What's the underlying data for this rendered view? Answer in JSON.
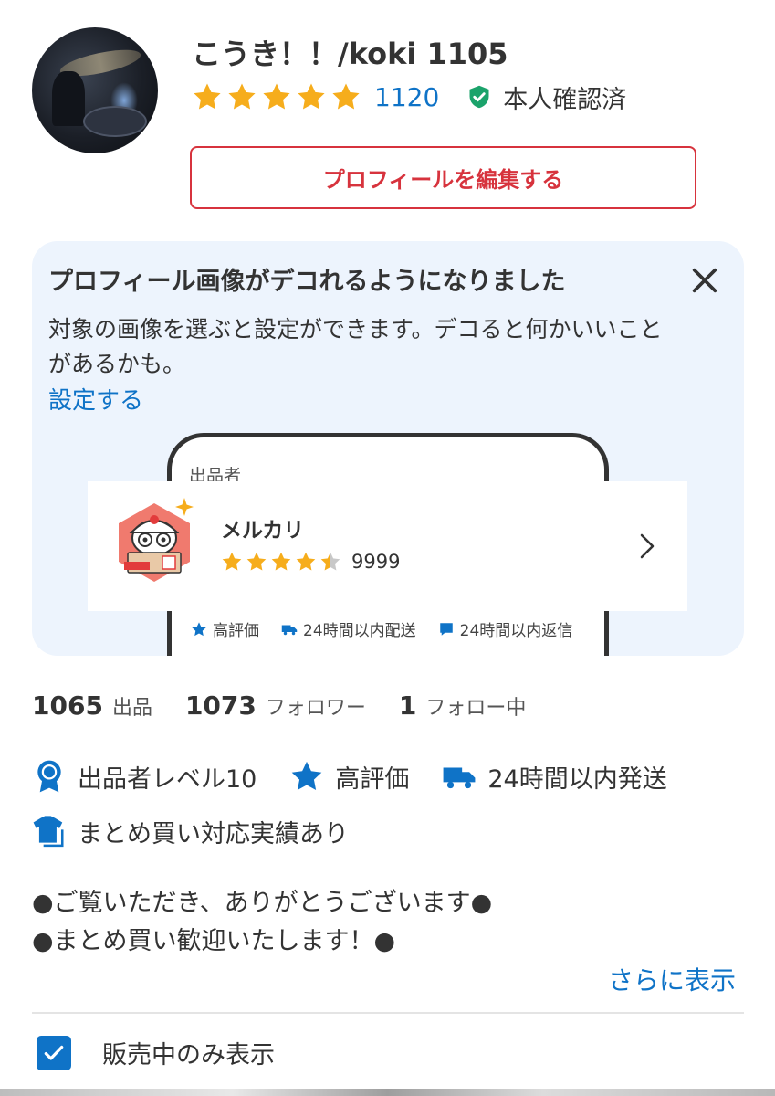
{
  "profile": {
    "username": "こうき！！/koki 1105",
    "rating_count": "1120",
    "rating_stars": 5,
    "verified_label": "本人確認済",
    "edit_button": "プロフィールを編集する"
  },
  "notice": {
    "title": "プロフィール画像がデコれるようになりました",
    "body": "対象の画像を選ぶと設定ができます。デコると何かいいことがあるかも。",
    "link": "設定する",
    "preview": {
      "seller_label": "出品者",
      "seller_name": "メルカリ",
      "seller_rating": 4.5,
      "seller_count": "9999",
      "badges": [
        "高評価",
        "24時間以内配送",
        "24時間以内返信"
      ]
    }
  },
  "stats": [
    {
      "value": "1065",
      "label": "出品"
    },
    {
      "value": "1073",
      "label": "フォロワー"
    },
    {
      "value": "1",
      "label": "フォロー中"
    }
  ],
  "badges": {
    "level": "出品者レベル10",
    "high_rating": "高評価",
    "shipping": "24時間以内発送",
    "bulk": "まとめ買い対応実績あり"
  },
  "description": {
    "line1": "●ご覧いただき、ありがとうございます●",
    "line2": "●まとめ買い歓迎いたします！●",
    "more": "さらに表示"
  },
  "filter": {
    "label": "販売中のみ表示",
    "checked": true
  },
  "colors": {
    "star": "#f6ad1c",
    "link": "#0f73c7",
    "accent_red": "#d7333d",
    "verified": "#1ba36b",
    "notice_bg": "#edf4fd"
  }
}
